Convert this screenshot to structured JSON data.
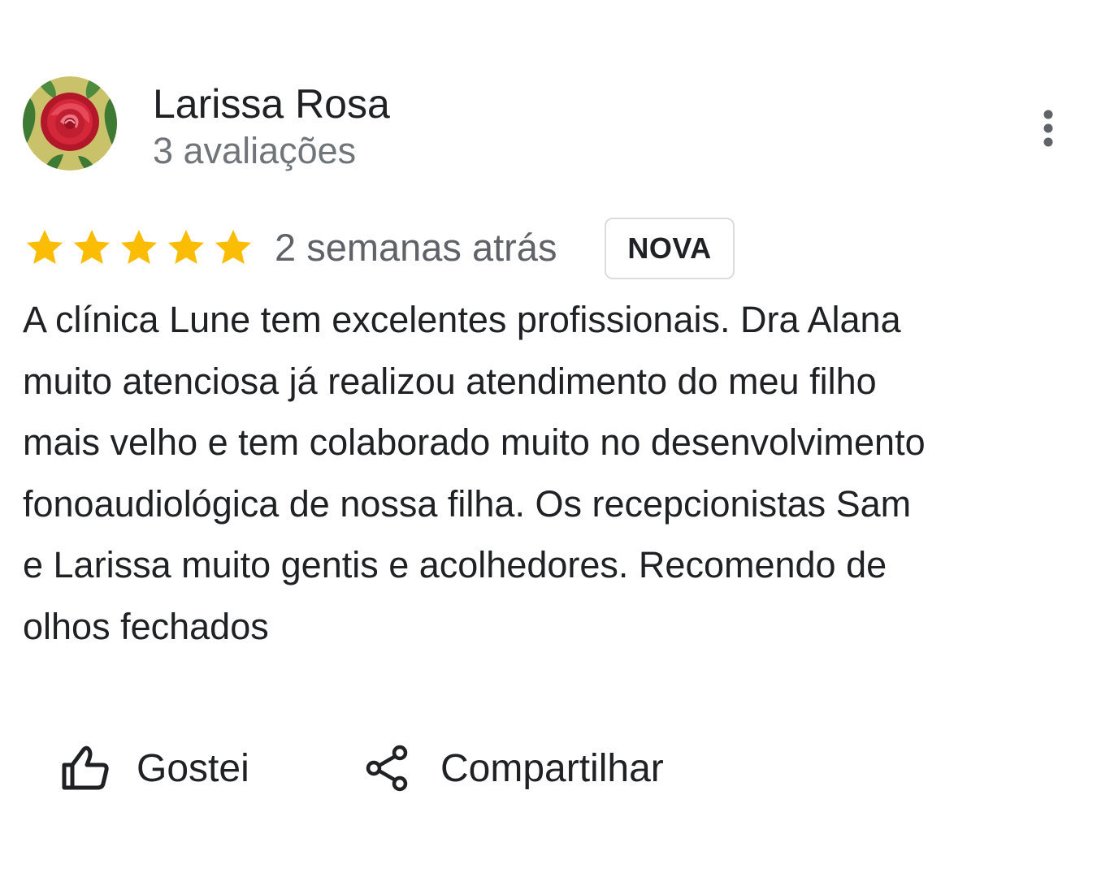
{
  "review": {
    "author_name": "Larissa Rosa",
    "author_review_count": "3 avaliações",
    "avatar_icon": "rose-avatar-icon",
    "more_icon": "more-vertical-icon",
    "rating": 5,
    "rating_max": 5,
    "star_color": "#fbbc04",
    "date": "2 semanas atrás",
    "badge": "NOVA",
    "text_lines": [
      "A clínica Lune tem excelentes profissionais. Dra Alana",
      "muito atenciosa já realizou atendimento do meu filho",
      "mais velho e tem colaborado muito no desenvolvimento",
      "fonoaudiológica de nossa filha. Os recepcionistas Sam",
      "e Larissa muito gentis e acolhedores. Recomendo de",
      "olhos fechados"
    ]
  },
  "actions": {
    "like_label": "Gostei",
    "like_icon": "thumbs-up-icon",
    "share_label": "Compartilhar",
    "share_icon": "share-icon"
  }
}
